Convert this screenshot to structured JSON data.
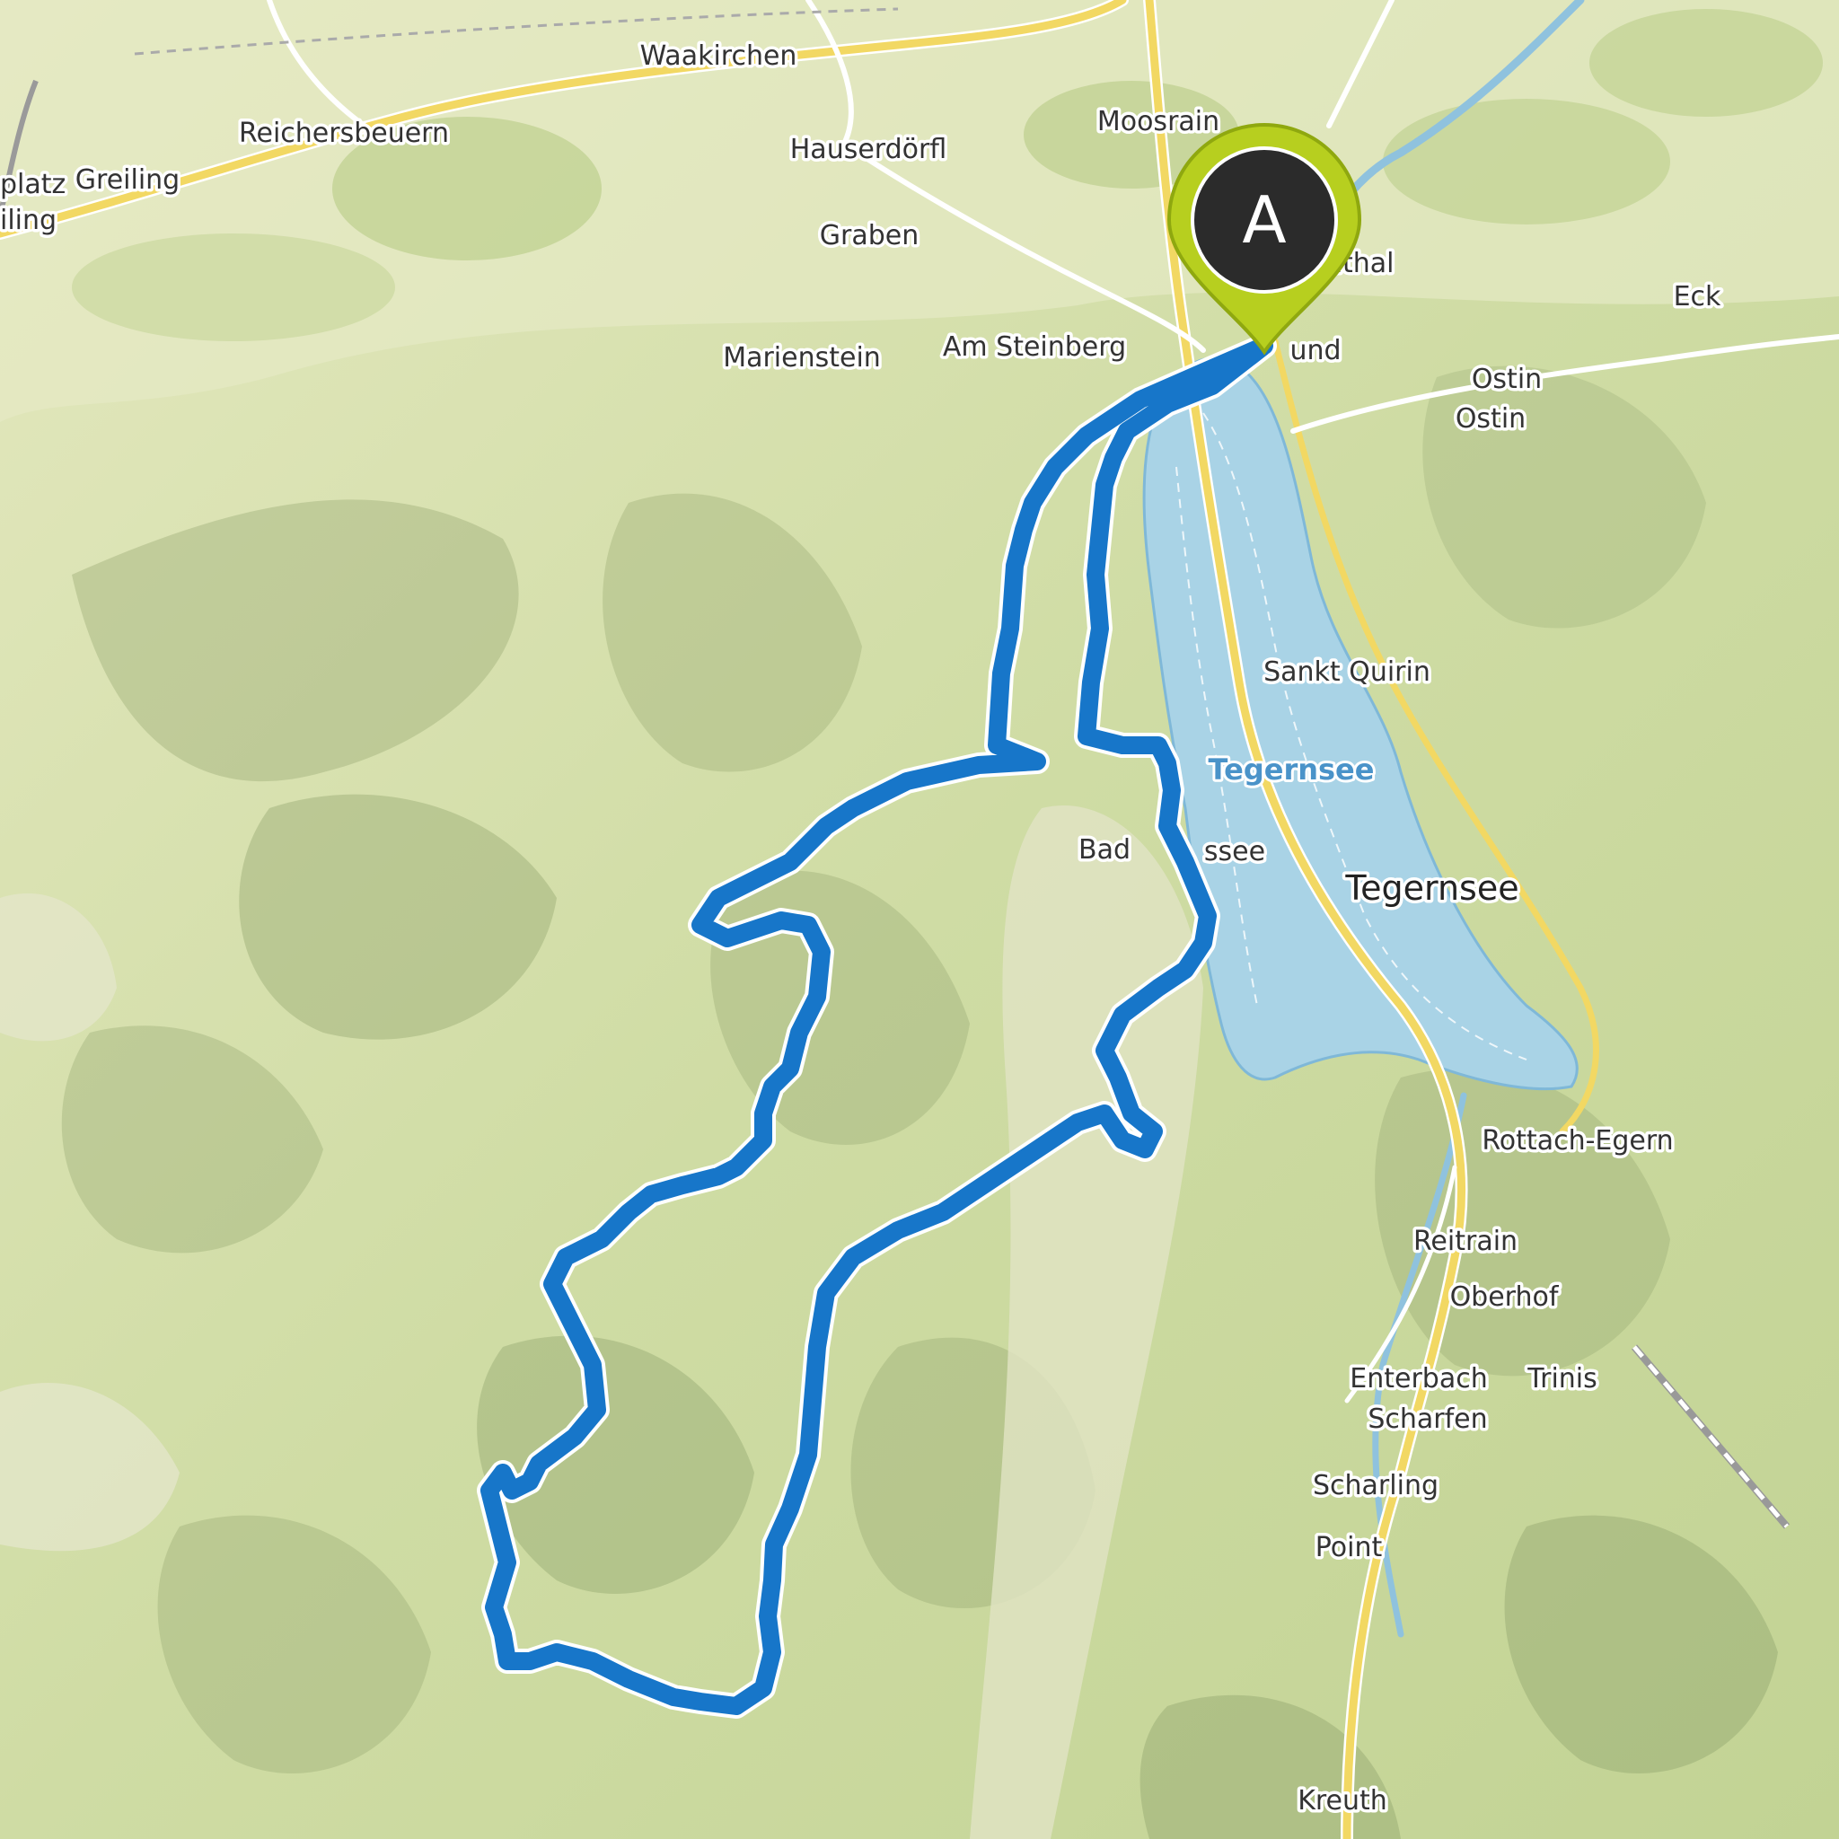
{
  "map": {
    "route_color": "#1776c9",
    "lake_color": "#a9d3e6",
    "terrain_color": "#c5d497",
    "road_color": "#f2d863",
    "marker": {
      "letter": "A",
      "fill": "#2b2b2b",
      "ring": "#b7cf1f",
      "icon": "map-pin-icon"
    },
    "lake_label": "Tegernsee",
    "places": {
      "waakirchen": "Waakirchen",
      "reichersbeuern": "Reichersbeuern",
      "greiling": "Greiling",
      "platz": "platz",
      "iling": "iling",
      "moosrain": "Moosrain",
      "hauserdoerfl": "Hauserdörfl",
      "graben": "Graben",
      "enthal": "enthal",
      "eck": "Eck",
      "marienstein": "Marienstein",
      "am_steinberg": "Am Steinberg",
      "und": "und",
      "ostin1": "Ostin",
      "ostin2": "Ostin",
      "sankt_quirin": "Sankt Quirin",
      "bad": "Bad",
      "ssee": "ssee",
      "tegernsee_town": "Tegernsee",
      "rottach_egern": "Rottach-Egern",
      "reitrain": "Reitrain",
      "oberhof": "Oberhof",
      "enterbach": "Enterbach",
      "trinis": "Trinis",
      "scharfen": "Scharfen",
      "scharling": "Scharling",
      "point": "Point",
      "kreuth": "Kreuth"
    }
  }
}
